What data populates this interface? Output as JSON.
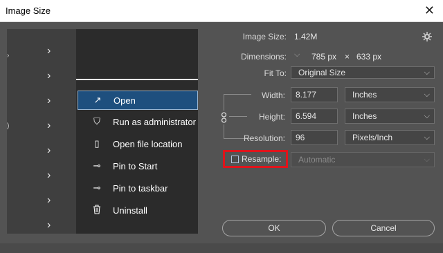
{
  "window": {
    "title": "Image Size",
    "close_glyph": "✕"
  },
  "preview": {
    "menu_items": [
      {
        "label": "Open",
        "icon": "open-in-new-icon",
        "glyph": "↗",
        "active": true
      },
      {
        "label": "Run as administrator",
        "icon": "shield-icon",
        "glyph": "⛉",
        "active": false
      },
      {
        "label": "Open file location",
        "icon": "file-location-icon",
        "glyph": "▯",
        "active": false
      },
      {
        "label": "Pin to Start",
        "icon": "pin-icon",
        "glyph": "⊸",
        "active": false
      },
      {
        "label": "Pin to taskbar",
        "icon": "pin-taskbar-icon",
        "glyph": "⊸",
        "active": false
      },
      {
        "label": "Uninstall",
        "icon": "trash-icon",
        "glyph": "🗑",
        "active": false
      }
    ],
    "chevron_glyph": "›"
  },
  "image_size": {
    "label": "Image Size:",
    "value": "1.42M"
  },
  "dimensions": {
    "label": "Dimensions:",
    "width": "785 px",
    "times": "×",
    "height": "633 px"
  },
  "fit_to": {
    "label": "Fit To:",
    "value": "Original Size"
  },
  "width": {
    "label": "Width:",
    "value": "8.177",
    "unit": "Inches"
  },
  "height": {
    "label": "Height:",
    "value": "6.594",
    "unit": "Inches"
  },
  "resolution": {
    "label": "Resolution:",
    "value": "96",
    "unit": "Pixels/Inch"
  },
  "resample": {
    "label": "Resample:",
    "checked": false,
    "method": "Automatic"
  },
  "buttons": {
    "ok": "OK",
    "cancel": "Cancel"
  },
  "colors": {
    "accent": "#1e4f7e",
    "highlight": "#e0141b",
    "background": "#535353"
  }
}
